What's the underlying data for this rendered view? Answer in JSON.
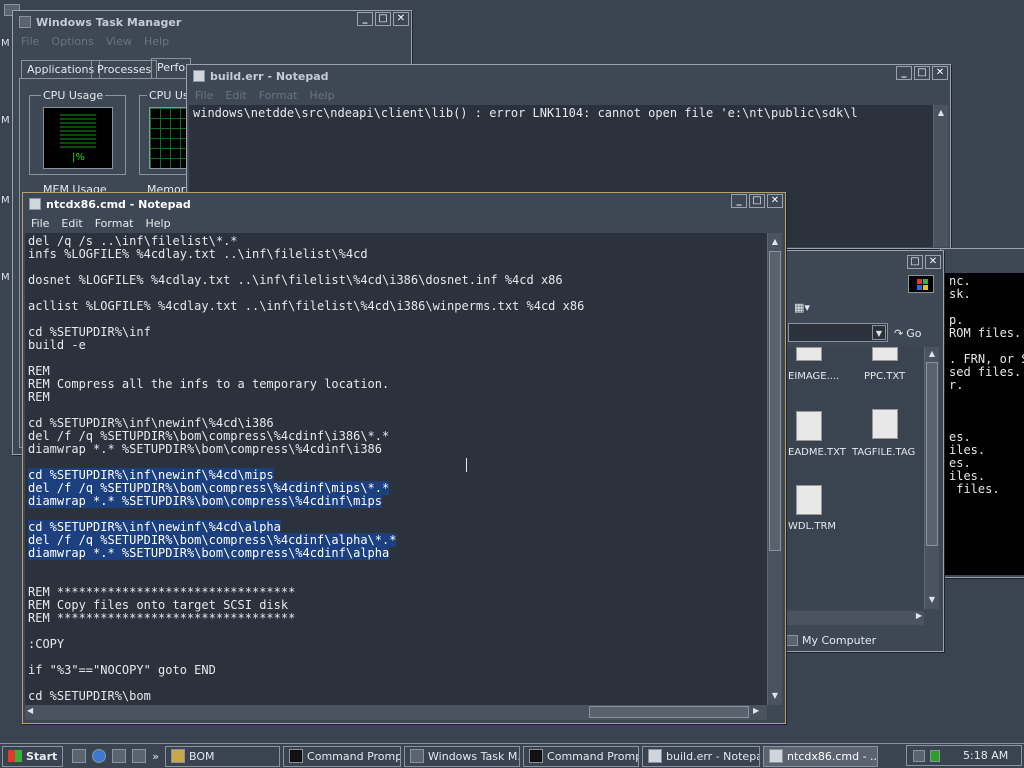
{
  "task_manager": {
    "title": "Windows Task Manager",
    "menu": [
      "File",
      "Options",
      "View",
      "Help"
    ],
    "tabs": [
      "Applications",
      "Processes",
      "Performance"
    ],
    "cpu_usage_label": "CPU Usage",
    "cpu_history_label": "CPU Usage",
    "mem_usage_label": "MEM Usage",
    "mem_history_label": "Memory",
    "cpu_percent": "|%"
  },
  "build_err": {
    "title": "build.err - Notepad",
    "menu": [
      "File",
      "Edit",
      "Format",
      "Help"
    ],
    "content": "windows\\netdde\\src\\ndeapi\\client\\lib() : error LNK1104: cannot open file 'e:\\nt\\public\\sdk\\l"
  },
  "notepad_main": {
    "title": "ntcdx86.cmd - Notepad",
    "menu": [
      "File",
      "Edit",
      "Format",
      "Help"
    ],
    "lines": [
      {
        "text": "del /q /s ..\\inf\\filelist\\*.*",
        "sel": false
      },
      {
        "text": "infs %LOGFILE% %4cdlay.txt ..\\inf\\filelist\\%4cd",
        "sel": false
      },
      {
        "text": "",
        "sel": false
      },
      {
        "text": "dosnet %LOGFILE% %4cdlay.txt ..\\inf\\filelist\\%4cd\\i386\\dosnet.inf %4cd x86",
        "sel": false
      },
      {
        "text": "",
        "sel": false
      },
      {
        "text": "acllist %LOGFILE% %4cdlay.txt ..\\inf\\filelist\\%4cd\\i386\\winperms.txt %4cd x86",
        "sel": false
      },
      {
        "text": "",
        "sel": false
      },
      {
        "text": "cd %SETUPDIR%\\inf",
        "sel": false
      },
      {
        "text": "build -e",
        "sel": false
      },
      {
        "text": "",
        "sel": false
      },
      {
        "text": "REM",
        "sel": false
      },
      {
        "text": "REM Compress all the infs to a temporary location.",
        "sel": false
      },
      {
        "text": "REM",
        "sel": false
      },
      {
        "text": "",
        "sel": false
      },
      {
        "text": "cd %SETUPDIR%\\inf\\newinf\\%4cd\\i386",
        "sel": false
      },
      {
        "text": "del /f /q %SETUPDIR%\\bom\\compress\\%4cdinf\\i386\\*.*",
        "sel": false
      },
      {
        "text": "diamwrap *.* %SETUPDIR%\\bom\\compress\\%4cdinf\\i386",
        "sel": false
      },
      {
        "text": "",
        "sel": false
      },
      {
        "text": "cd %SETUPDIR%\\inf\\newinf\\%4cd\\mips",
        "sel": true
      },
      {
        "text": "del /f /q %SETUPDIR%\\bom\\compress\\%4cdinf\\mips\\*.*",
        "sel": true
      },
      {
        "text": "diamwrap *.* %SETUPDIR%\\bom\\compress\\%4cdinf\\mips",
        "sel": true
      },
      {
        "text": "",
        "sel": false
      },
      {
        "text": "cd %SETUPDIR%\\inf\\newinf\\%4cd\\alpha",
        "sel": true
      },
      {
        "text": "del /f /q %SETUPDIR%\\bom\\compress\\%4cdinf\\alpha\\*.*",
        "sel": true
      },
      {
        "text": "diamwrap *.* %SETUPDIR%\\bom\\compress\\%4cdinf\\alpha",
        "sel": true
      },
      {
        "text": "",
        "sel": false
      },
      {
        "text": "",
        "sel": false
      },
      {
        "text": "REM *********************************",
        "sel": false
      },
      {
        "text": "REM Copy files onto target SCSI disk",
        "sel": false
      },
      {
        "text": "REM *********************************",
        "sel": false
      },
      {
        "text": "",
        "sel": false
      },
      {
        "text": ":COPY",
        "sel": false
      },
      {
        "text": "",
        "sel": false
      },
      {
        "text": "if \"%3\"==\"NOCOPY\" goto END",
        "sel": false
      },
      {
        "text": "",
        "sel": false
      },
      {
        "text": "cd %SETUPDIR%\\bom",
        "sel": false
      }
    ]
  },
  "explorer": {
    "go_label": "Go",
    "status": "My Computer",
    "files": [
      "EIMAGE....",
      "PPC.TXT",
      "EADME.TXT",
      "TAGFILE.TAG",
      "WDL.TRM"
    ]
  },
  "cmd_window": {
    "lines": [
      "nc.",
      "sk.",
      "",
      "p.",
      "ROM files.",
      "",
      ". FRN, or S",
      "sed files.",
      "r.",
      "",
      "",
      "",
      "es.",
      "iles.",
      "es.",
      "iles.",
      " files."
    ]
  },
  "desktop_letters": [
    "M",
    "M",
    "M",
    "M"
  ],
  "taskbar": {
    "start_label": "Start",
    "tasks": [
      {
        "label": "BOM",
        "active": false
      },
      {
        "label": "Command Promp...",
        "active": false
      },
      {
        "label": "Windows Task M...",
        "active": false
      },
      {
        "label": "Command Prompt",
        "active": false
      },
      {
        "label": "build.err - Notepad",
        "active": false
      },
      {
        "label": "ntcdx86.cmd - ...",
        "active": true
      }
    ],
    "clock": "5:18 AM",
    "chevron": "»"
  }
}
